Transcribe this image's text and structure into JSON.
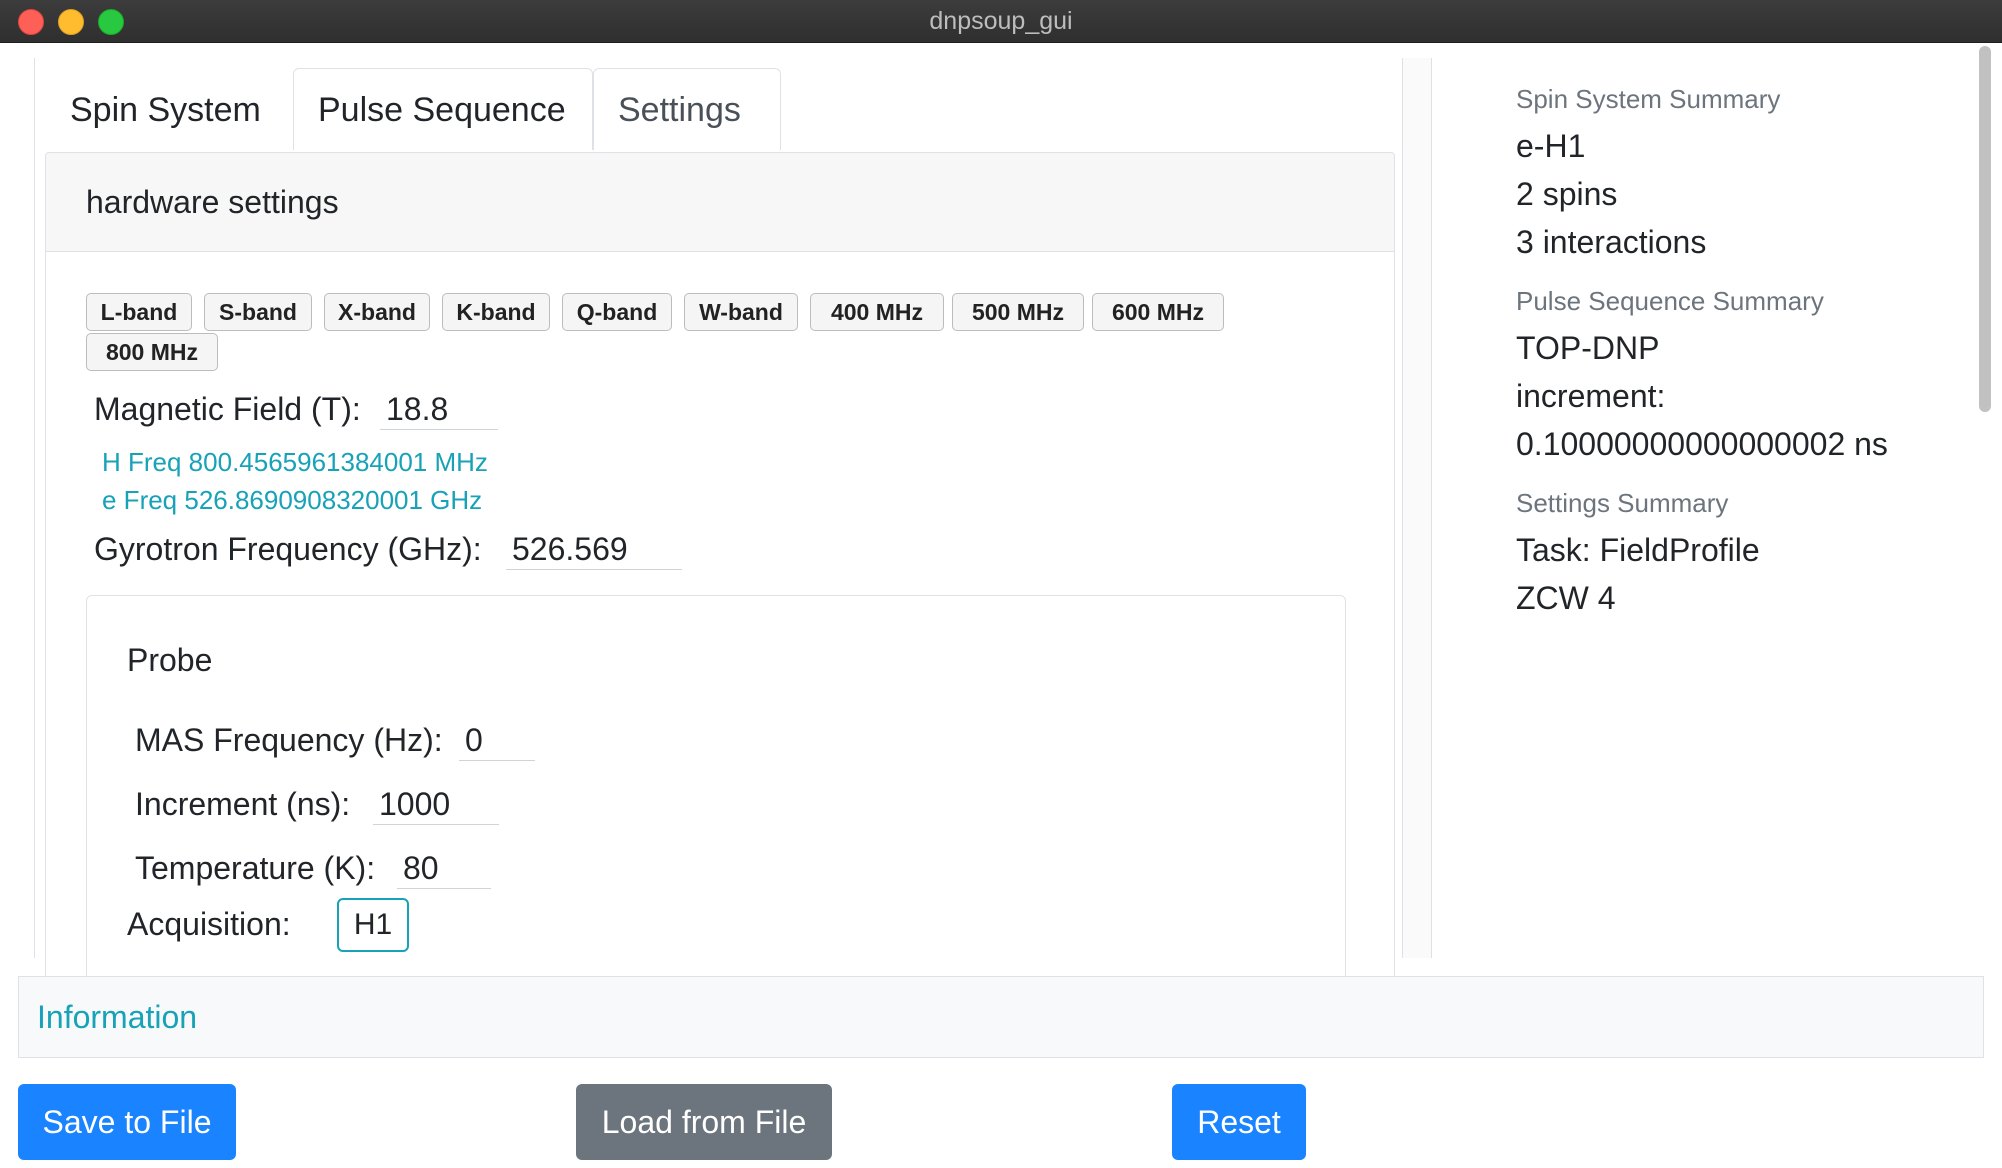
{
  "window": {
    "title": "dnpsoup_gui"
  },
  "tabs": [
    {
      "label": "Spin System"
    },
    {
      "label": "Pulse Sequence"
    },
    {
      "label": "Settings"
    }
  ],
  "hardware": {
    "header": "hardware settings",
    "presets": [
      "L-band",
      "S-band",
      "X-band",
      "K-band",
      "Q-band",
      "W-band",
      "400 MHz",
      "500 MHz",
      "600 MHz",
      "800 MHz"
    ],
    "magnetic_field_label": "Magnetic Field (T):",
    "magnetic_field_value": "18.8",
    "h_freq": "H Freq 800.4565961384001 MHz",
    "e_freq": "e Freq 526.8690908320001 GHz",
    "gyrotron_label": "Gyrotron Frequency (GHz):",
    "gyrotron_value": "526.569"
  },
  "probe": {
    "title": "Probe",
    "mas_label": "MAS Frequency (Hz):",
    "mas_value": "0",
    "increment_label": "Increment (ns):",
    "increment_value": "1000",
    "temperature_label": "Temperature (K):",
    "temperature_value": "80",
    "acquisition_label": "Acquisition:",
    "acquisition_value": "H1"
  },
  "summary": {
    "spin_title": "Spin System Summary",
    "spin_lines": [
      "e-H1",
      "2 spins",
      "3 interactions"
    ],
    "pulse_title": "Pulse Sequence Summary",
    "pulse_lines": [
      "TOP-DNP",
      "increment:",
      "0.10000000000000002 ns"
    ],
    "settings_title": "Settings Summary",
    "settings_lines": [
      "Task: FieldProfile",
      "ZCW 4"
    ]
  },
  "info": {
    "label": "Information"
  },
  "buttons": {
    "save": "Save to File",
    "load": "Load from File",
    "reset": "Reset"
  },
  "colors": {
    "primary": "#1a83ff",
    "secondary": "#6c757d",
    "info": "#17a2b8"
  }
}
